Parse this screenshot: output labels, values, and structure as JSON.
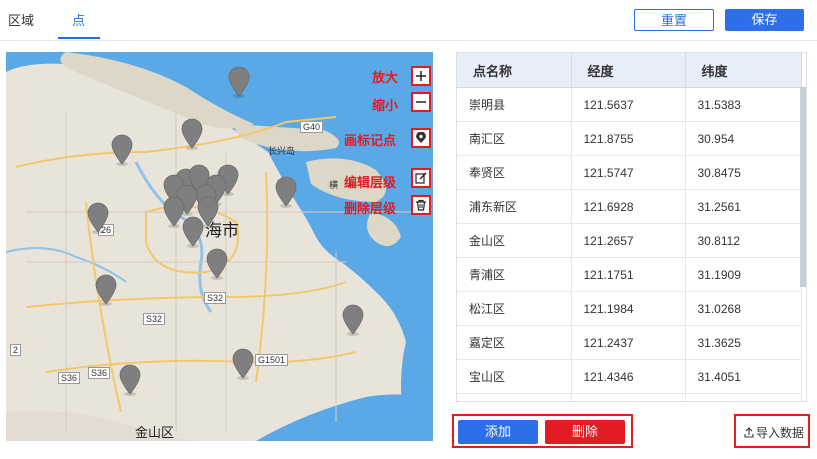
{
  "tabs": [
    {
      "label": "区域",
      "active": false
    },
    {
      "label": "点",
      "active": true
    }
  ],
  "header_buttons": {
    "reset": "重置",
    "save": "保存"
  },
  "map": {
    "city_label": "海市",
    "district_label": "金山区",
    "road_labels": {
      "g40": "G40",
      "changxing": "长兴岛",
      "heng": "横",
      "s32a": "S32",
      "s32b": "S32",
      "g1501": "G1501",
      "s36a": "S36",
      "s36b": "S36",
      "num2": "2",
      "s26": "26"
    },
    "controls": [
      {
        "id": "zoom-in",
        "label": "放大",
        "icon": "plus-icon"
      },
      {
        "id": "zoom-out",
        "label": "缩小",
        "icon": "minus-icon"
      },
      {
        "id": "add-marker",
        "label": "画标记点",
        "icon": "map-pin-icon"
      },
      {
        "id": "edit-layer",
        "label": "编辑层级",
        "icon": "edit-icon"
      },
      {
        "id": "delete-layer",
        "label": "删除层级",
        "icon": "trash-icon"
      }
    ],
    "colors": {
      "water": "#5aa9e6",
      "land": "#e8e4da",
      "marker": "#7f7f7f",
      "highlight": "#e31b23"
    }
  },
  "table": {
    "columns": [
      "点名称",
      "经度",
      "纬度"
    ],
    "rows": [
      [
        "崇明县",
        "121.5637",
        "31.5383"
      ],
      [
        "南汇区",
        "121.8755",
        "30.954"
      ],
      [
        "奉贤区",
        "121.5747",
        "30.8475"
      ],
      [
        "浦东新区",
        "121.6928",
        "31.2561"
      ],
      [
        "金山区",
        "121.2657",
        "30.8112"
      ],
      [
        "青浦区",
        "121.1751",
        "31.1909"
      ],
      [
        "松江区",
        "121.1984",
        "31.0268"
      ],
      [
        "嘉定区",
        "121.2437",
        "31.3625"
      ],
      [
        "宝山区",
        "121.4346",
        "31.4051"
      ],
      [
        "",
        "",
        ""
      ]
    ]
  },
  "actions": {
    "add": "添加",
    "delete": "删除",
    "import": "导入数据"
  }
}
